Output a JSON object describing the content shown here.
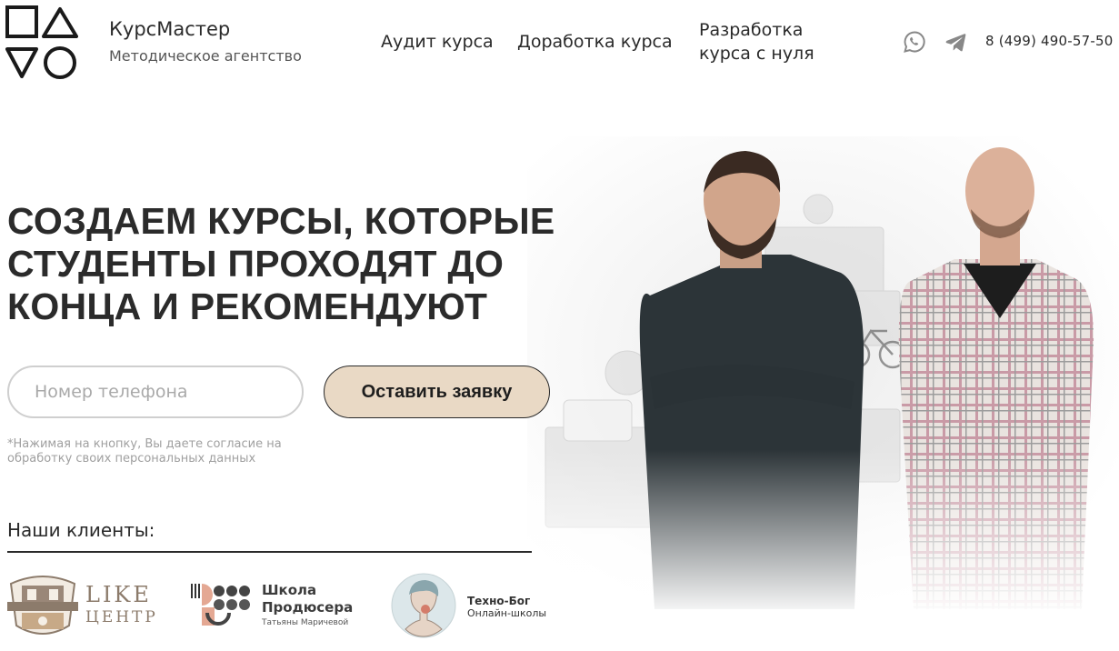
{
  "brand": {
    "name": "КурсМастер",
    "subtitle": "Методическое агентство"
  },
  "nav": {
    "audit": "Аудит курса",
    "improve": "Доработка курса",
    "develop_line1": "Разработка",
    "develop_line2": "курса с нуля"
  },
  "contacts": {
    "whatsapp_icon": "whatsapp-icon",
    "telegram_icon": "telegram-icon",
    "phone": "8 (499) 490-57-50"
  },
  "hero": {
    "title_line1": "СОЗДАЕМ КУРСЫ, КОТОРЫЕ",
    "title_line2": "СТУДЕНТЫ ПРОХОДЯТ ДО",
    "title_line3": "КОНЦА И РЕКОМЕНДУЮТ",
    "phone_placeholder": "Номер телефона",
    "submit_label": "Оставить заявку",
    "consent": "*Нажимая на кнопку, Вы даете согласие на обработку своих персональных данных"
  },
  "clients": {
    "title": "Наши клиенты:",
    "like": {
      "line1": "LIKE",
      "line2": "ЦЕНТР"
    },
    "school": {
      "line1": "Школа",
      "line2": "Продюсера",
      "line3": "Татьяны Маричевой"
    },
    "techno": {
      "line1": "Техно-Бог",
      "line2": "Онлайн-школы"
    }
  },
  "colors": {
    "text": "#2a2a2a",
    "accent_button": "#e9d9c5",
    "input_border": "#cfcfcf",
    "muted": "#a0a0a0",
    "brand_brown": "#8c7b6b"
  }
}
